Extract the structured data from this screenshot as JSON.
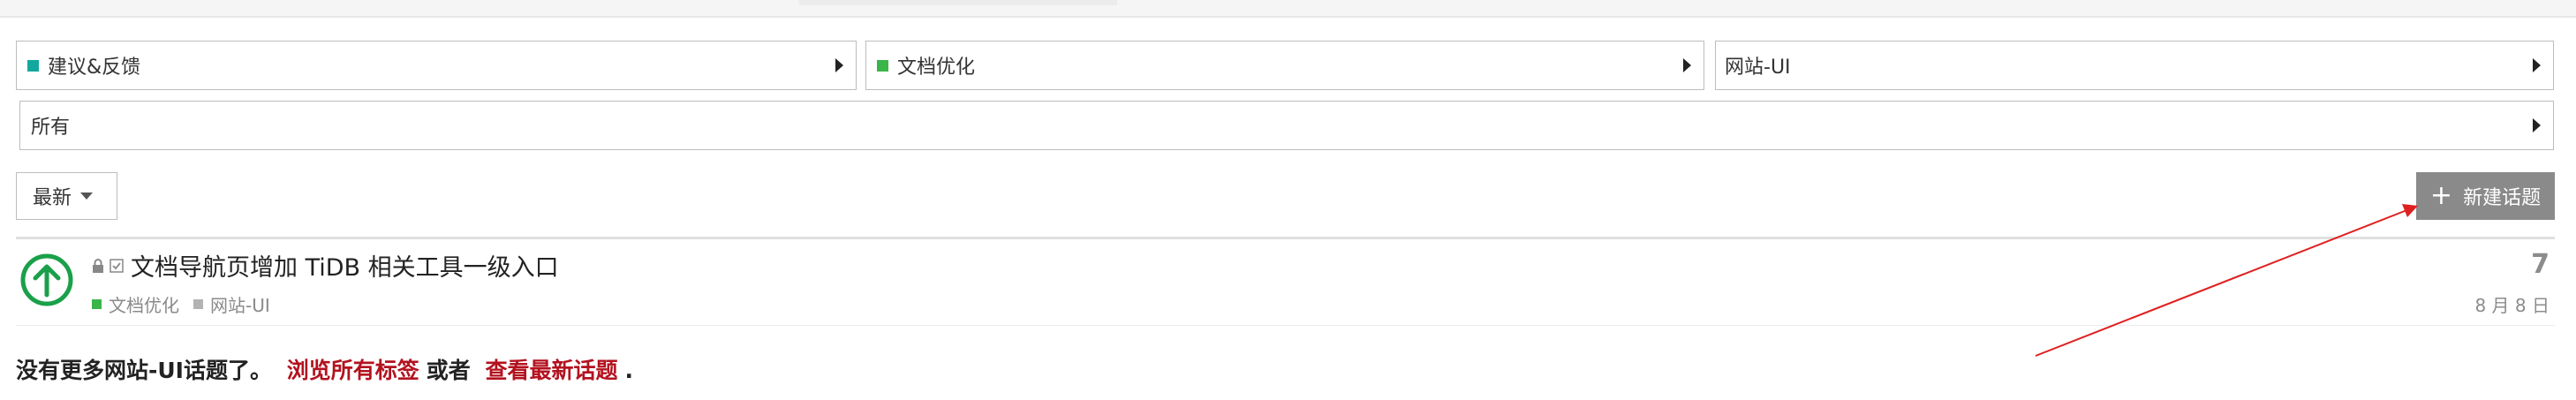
{
  "filters": {
    "category": {
      "label": "建议&反馈",
      "color": "#12a89d"
    },
    "subcategory": {
      "label": "文档优化",
      "color": "#3ab54a"
    },
    "tag": {
      "label": "网站-UI"
    },
    "scope": {
      "label": "所有"
    }
  },
  "controls": {
    "sort_label": "最新",
    "new_topic_label": "新建话题"
  },
  "topics": [
    {
      "title": "文档导航页增加 TiDB 相关工具一级入口",
      "category": {
        "label": "文档优化",
        "color": "#3ab54a"
      },
      "tag": {
        "label": "网站-UI",
        "color": "#b3b3b3"
      },
      "replies": "7",
      "date": "8 月 8 日",
      "status_icon": "up-arrow-circle-icon"
    }
  ],
  "footer": {
    "message": "没有更多网站-UI话题了。",
    "link_all_tags": "浏览所有标签",
    "or_text": "或者",
    "link_latest": "查看最新话题",
    "end_punct": "."
  },
  "annotation": {
    "color": "#e02020"
  }
}
